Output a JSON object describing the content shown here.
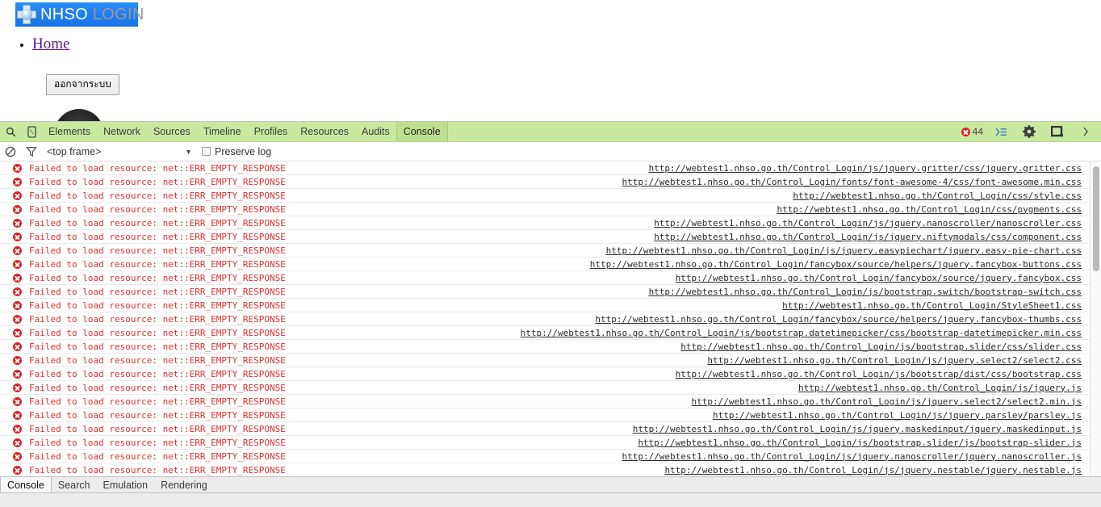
{
  "page": {
    "logo": {
      "brand": "NHSO",
      "suffix": "LOGIN",
      "icon": "medical-cross-icon"
    },
    "nav": {
      "home_label": "Home"
    },
    "logout_label": "ออกจากระบบ"
  },
  "devtools": {
    "toolbar": {
      "search_icon": "search-icon",
      "device_icon": "device-toolbar-icon",
      "tabs": [
        {
          "label": "Elements",
          "selected": false
        },
        {
          "label": "Network",
          "selected": false
        },
        {
          "label": "Sources",
          "selected": false
        },
        {
          "label": "Timeline",
          "selected": false
        },
        {
          "label": "Profiles",
          "selected": false
        },
        {
          "label": "Resources",
          "selected": false
        },
        {
          "label": "Audits",
          "selected": false
        },
        {
          "label": "Console",
          "selected": true
        }
      ],
      "error_count": "44",
      "error_icon": "error-circle-icon",
      "console_drawer_icon": "show-drawer-icon",
      "settings_icon": "gear-icon",
      "dock_icon": "dock-position-icon",
      "more_icon": "more-options-icon",
      "accent_color": "#c9e9a0"
    },
    "filterbar": {
      "clear_icon": "clear-console-icon",
      "filter_icon": "filter-icon",
      "frame_value": "<top frame>",
      "caret_icon": "chevron-down-icon",
      "preserve_log_label": "Preserve log",
      "preserve_log_checked": false
    },
    "console": {
      "error_text": "Failed to load resource: net::ERR_EMPTY_RESPONSE",
      "error_color": "#e03030",
      "rows": [
        "http://webtest1.nhso.go.th/Control_Login/js/jquery.gritter/css/jquery.gritter.css",
        "http://webtest1.nhso.go.th/Control_Login/fonts/font-awesome-4/css/font-awesome.min.css",
        "http://webtest1.nhso.go.th/Control_Login/css/style.css",
        "http://webtest1.nhso.go.th/Control_Login/css/pygments.css",
        "http://webtest1.nhso.go.th/Control_Login/js/jquery.nanoscroller/nanoscroller.css",
        "http://webtest1.nhso.go.th/Control_Login/js/jquery.niftymodals/css/component.css",
        "http://webtest1.nhso.go.th/Control_Login/js/jquery.easypiechart/jquery.easy-pie-chart.css",
        "http://webtest1.nhso.go.th/Control_Login/fancybox/source/helpers/jquery.fancybox-buttons.css",
        "http://webtest1.nhso.go.th/Control_Login/fancybox/source/jquery.fancybox.css",
        "http://webtest1.nhso.go.th/Control_Login/js/bootstrap.switch/bootstrap-switch.css",
        "http://webtest1.nhso.go.th/Control_Login/StyleSheet1.css",
        "http://webtest1.nhso.go.th/Control_Login/fancybox/source/helpers/jquery.fancybox-thumbs.css",
        "http://webtest1.nhso.go.th/Control_Login/js/bootstrap.datetimepicker/css/bootstrap-datetimepicker.min.css",
        "http://webtest1.nhso.go.th/Control_Login/js/bootstrap.slider/css/slider.css",
        "http://webtest1.nhso.go.th/Control_Login/js/jquery.select2/select2.css",
        "http://webtest1.nhso.go.th/Control_Login/js/bootstrap/dist/css/bootstrap.css",
        "http://webtest1.nhso.go.th/Control_Login/js/jquery.js",
        "http://webtest1.nhso.go.th/Control_Login/js/jquery.select2/select2.min.js",
        "http://webtest1.nhso.go.th/Control_Login/js/jquery.parsley/parsley.js",
        "http://webtest1.nhso.go.th/Control_Login/js/jquery.maskedinput/jquery.maskedinput.js",
        "http://webtest1.nhso.go.th/Control_Login/js/bootstrap.slider/js/bootstrap-slider.js",
        "http://webtest1.nhso.go.th/Control_Login/js/jquery.nanoscroller/jquery.nanoscroller.js",
        "http://webtest1.nhso.go.th/Control_Login/js/jquery.nestable/jquery.nestable.js"
      ]
    },
    "drawer": {
      "tabs": [
        {
          "label": "Console",
          "selected": true
        },
        {
          "label": "Search",
          "selected": false
        },
        {
          "label": "Emulation",
          "selected": false
        },
        {
          "label": "Rendering",
          "selected": false
        }
      ]
    }
  }
}
